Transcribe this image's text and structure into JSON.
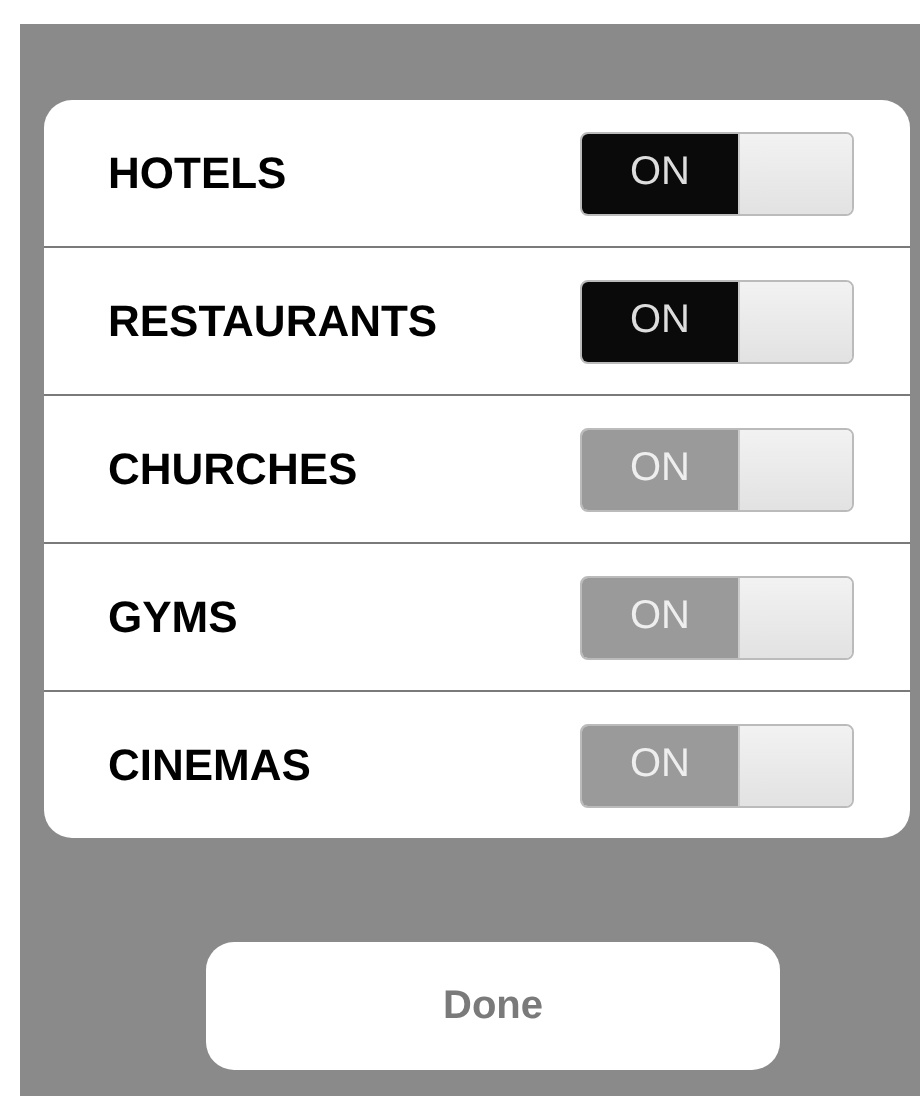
{
  "rows": [
    {
      "label": "HOTELS",
      "switch_text": "ON",
      "on": true,
      "disabled": false
    },
    {
      "label": "RESTAURANTS",
      "switch_text": "ON",
      "on": true,
      "disabled": false
    },
    {
      "label": "CHURCHES",
      "switch_text": "ON",
      "on": true,
      "disabled": true
    },
    {
      "label": "GYMS",
      "switch_text": "ON",
      "on": true,
      "disabled": true
    },
    {
      "label": "CINEMAS",
      "switch_text": "ON",
      "on": true,
      "disabled": true
    }
  ],
  "done_button": "Done"
}
